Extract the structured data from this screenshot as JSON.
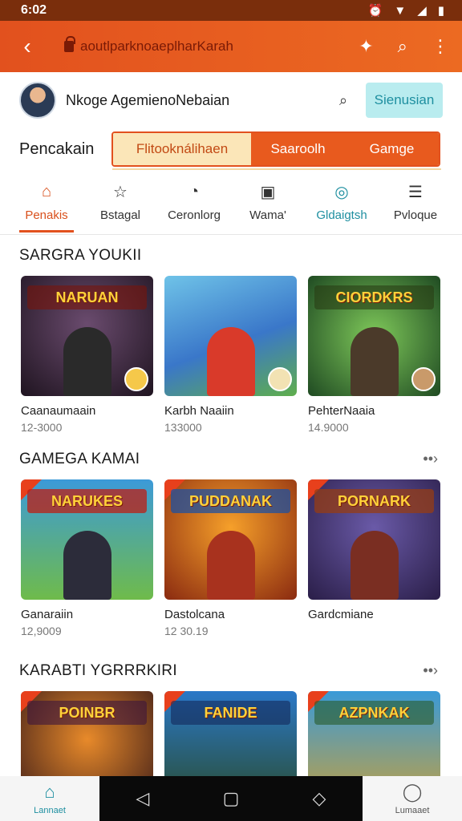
{
  "status": {
    "time": "6:02",
    "icons": [
      "alarm-icon",
      "wifi-icon",
      "signal-icon",
      "battery-icon"
    ]
  },
  "appbar": {
    "url": "aoutlparknoaeplharKarah"
  },
  "profile": {
    "name": "Nkoge AgemienoNebaian",
    "signup_label": "Sienusian"
  },
  "categories": {
    "label": "Pencakain",
    "seg_a": "Flitooknálihaen",
    "seg_b": "Saaroolh",
    "seg_c": "Gamge"
  },
  "tabs": [
    {
      "label": "Penakis"
    },
    {
      "label": "Bstagal"
    },
    {
      "label": "Ceronlorg"
    },
    {
      "label": "Wama'"
    },
    {
      "label": "Gldaigtsh"
    },
    {
      "label": "Pvloque"
    }
  ],
  "sections": [
    {
      "title": "SARGRA YOUKII",
      "cards": [
        {
          "title": "Caanaumaain",
          "meta": "12-3000",
          "banner": "NARUAN"
        },
        {
          "title": "Karbh Naaiin",
          "meta": "133000",
          "banner": ""
        },
        {
          "title": "PehterNaaia",
          "meta": "14.9000",
          "banner": "CIORDKRS"
        }
      ]
    },
    {
      "title": "GAMEGA KAMAI",
      "cards": [
        {
          "title": "Ganaraiin",
          "meta": "12,9009",
          "banner": "NARUKES"
        },
        {
          "title": "Dastolcana",
          "meta": "12 30.19",
          "banner": "PUDDANAK"
        },
        {
          "title": "Gardcmiane",
          "meta": "",
          "banner": "PORNARK"
        }
      ]
    },
    {
      "title": "KARABTI YGRRRKIRI",
      "cards": [
        {
          "title": "",
          "meta": "",
          "banner": "POINBR"
        },
        {
          "title": "",
          "meta": "",
          "banner": "FANIDE"
        },
        {
          "title": "",
          "meta": "",
          "banner": "AZPNKAK"
        }
      ]
    }
  ],
  "bottomnav": {
    "home_label": "Lannaet",
    "profile_label": "Lumaaet"
  },
  "colors": {
    "accent": "#e2511e",
    "teal": "#1e8fa0"
  }
}
